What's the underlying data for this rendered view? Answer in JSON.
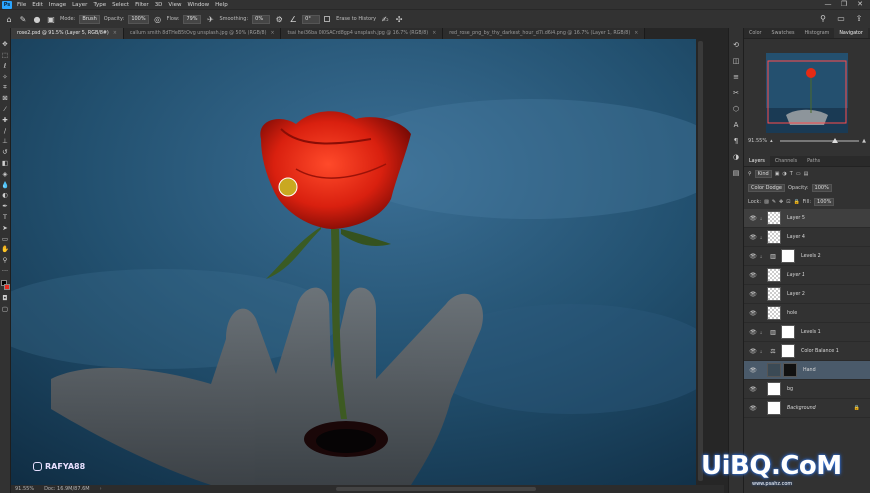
{
  "app": {
    "logo": "Ps"
  },
  "menu": [
    "File",
    "Edit",
    "Image",
    "Layer",
    "Type",
    "Select",
    "Filter",
    "3D",
    "View",
    "Window",
    "Help"
  ],
  "window_controls": {
    "minimize": "—",
    "maximize": "❐",
    "close": "✕"
  },
  "options": {
    "mode_label": "Mode:",
    "mode_value": "Brush",
    "opacity_label": "Opacity:",
    "opacity_value": "100%",
    "flow_label": "Flow:",
    "flow_value": "79%",
    "smoothing_label": "Smoothing:",
    "smoothing_value": "0%",
    "angle_value": "0°",
    "erase_history_label": "Erase to History"
  },
  "tabs": [
    {
      "label": "rose2.psd @ 91.5% (Layer 5, RGB/8#)",
      "active": true
    },
    {
      "label": "callum smith 8dTHeB5tOvg unsplash.jpg @ 50% (RGB/8)",
      "active": false
    },
    {
      "label": "tsai hei36ba 0I0SACrd8gp4 unsplash.jpg @ 16.7% (RGB/8)",
      "active": false
    },
    {
      "label": "red_rose_png_by_thy_darkest_hour_d7i.d6i4.png @ 16.7% (Layer 1, RGB/8)",
      "active": false
    }
  ],
  "status": {
    "zoom": "91.55%",
    "doc": "Doc: 16.9M/87.6M"
  },
  "watermark": "RAFYA88",
  "brand": {
    "main": "UiBQ.CoM",
    "sub": "www.psahz.com"
  },
  "navigator": {
    "tabs": [
      "Color",
      "Swatches",
      "Histogram",
      "Navigator"
    ],
    "active_tab": "Navigator",
    "zoom": "91.55%"
  },
  "layers_panel": {
    "tabs": [
      "Layers",
      "Channels",
      "Paths"
    ],
    "active_tab": "Layers",
    "filter_kind": "Kind",
    "blend_mode": "Color Dodge",
    "opacity_label": "Opacity:",
    "opacity_value": "100%",
    "lock_label": "Lock:",
    "fill_label": "Fill:",
    "fill_value": "100%",
    "layers": [
      {
        "name": "Layer 5",
        "type": "pixel",
        "selected": true
      },
      {
        "name": "Layer 4",
        "type": "pixel"
      },
      {
        "name": "Levels 2",
        "type": "levels"
      },
      {
        "name": "Layer 1",
        "type": "pixel",
        "italic": true
      },
      {
        "name": "Layer 2",
        "type": "pixel"
      },
      {
        "name": "hole",
        "type": "pixel"
      },
      {
        "name": "Levels 1",
        "type": "levels"
      },
      {
        "name": "Color Balance 1",
        "type": "colorbalance"
      },
      {
        "name": "Hand",
        "type": "photo",
        "highlight": true
      },
      {
        "name": "bg",
        "type": "white"
      },
      {
        "name": "Background",
        "type": "white",
        "italic": true,
        "locked": true
      }
    ]
  }
}
